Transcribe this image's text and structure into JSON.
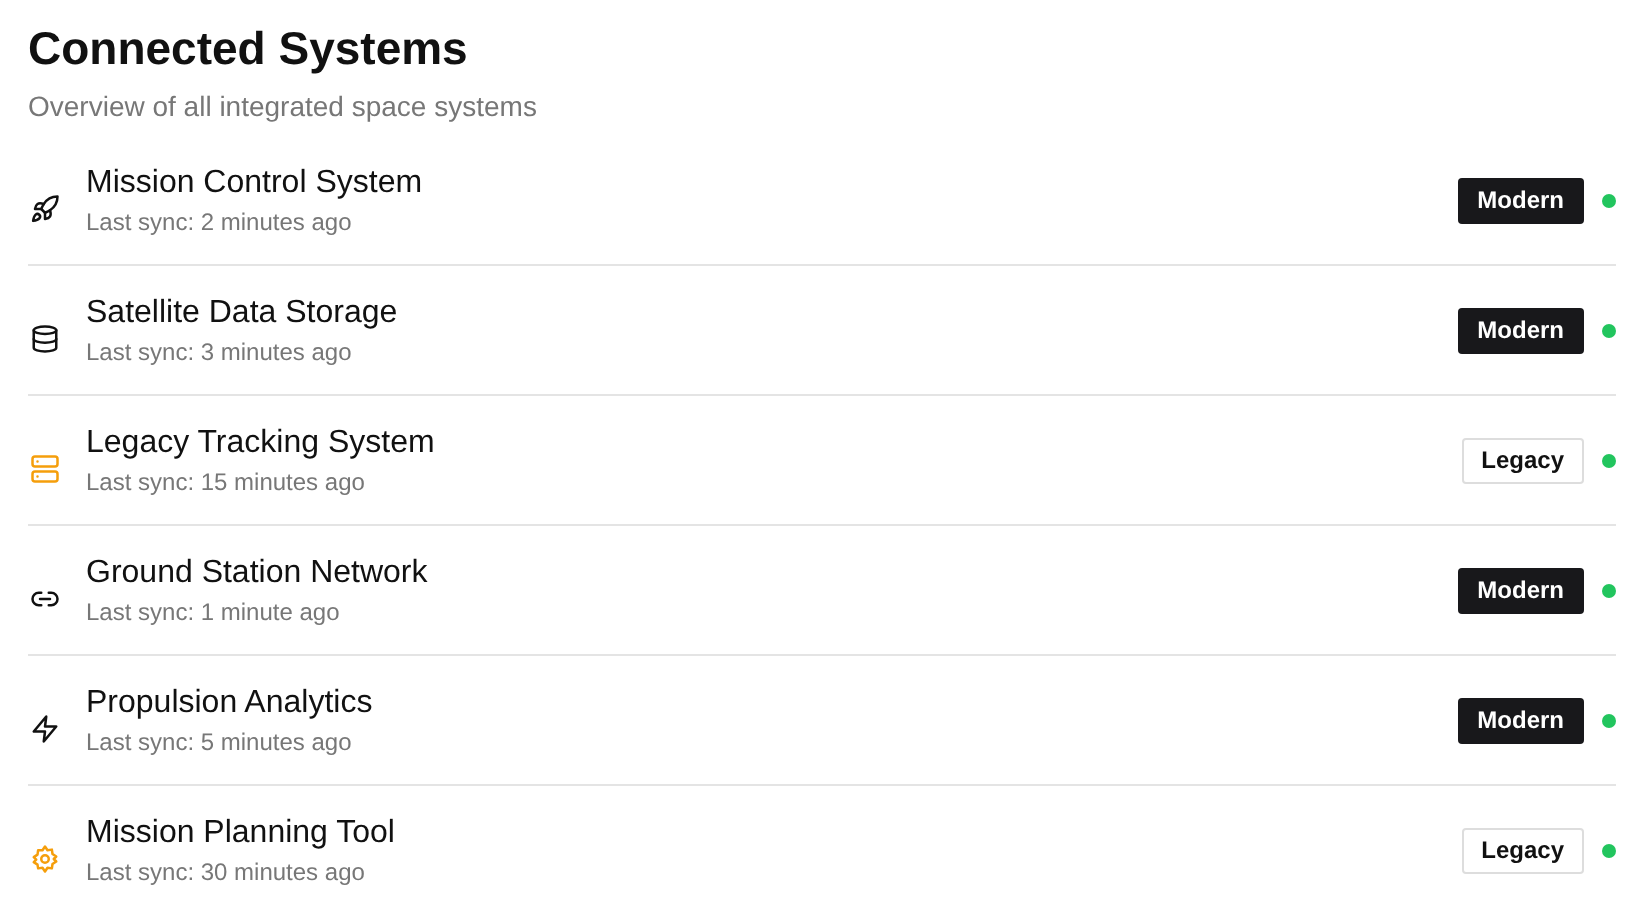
{
  "title": "Connected Systems",
  "subtitle": "Overview of all integrated space systems",
  "systems": [
    {
      "kind": "rocket",
      "name": "Mission Control System",
      "sync": "Last sync: 2 minutes ago",
      "badge": {
        "label": "Modern",
        "kind": "modern"
      },
      "color": "#22c55e"
    },
    {
      "kind": "database",
      "name": "Satellite Data Storage",
      "sync": "Last sync: 3 minutes ago",
      "badge": {
        "label": "Modern",
        "kind": "modern"
      },
      "color": "#22c55e"
    },
    {
      "kind": "server",
      "name": "Legacy Tracking System",
      "sync": "Last sync: 15 minutes ago",
      "badge": {
        "label": "Legacy",
        "kind": "legacy"
      },
      "color": "#22c55e"
    },
    {
      "kind": "link",
      "name": "Ground Station Network",
      "sync": "Last sync: 1 minute ago",
      "badge": {
        "label": "Modern",
        "kind": "modern"
      },
      "color": "#22c55e"
    },
    {
      "kind": "analytics",
      "name": "Propulsion Analytics",
      "sync": "Last sync: 5 minutes ago",
      "badge": {
        "label": "Modern",
        "kind": "modern"
      },
      "color": "#22c55e"
    },
    {
      "kind": "tool",
      "name": "Mission Planning Tool",
      "sync": "Last sync: 30 minutes ago",
      "badge": {
        "label": "Legacy",
        "kind": "legacy"
      },
      "color": "#22c55e"
    }
  ]
}
